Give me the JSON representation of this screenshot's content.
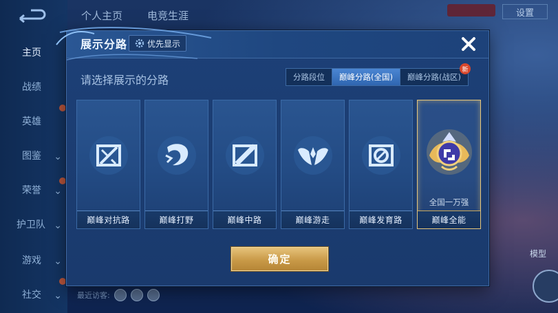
{
  "background": {
    "top_tabs": [
      "个人主页",
      "电竞生涯"
    ],
    "settings_label": "设置",
    "sidebar": {
      "items": [
        {
          "label": "主页",
          "active": true
        },
        {
          "label": "战绩"
        },
        {
          "label": "英雄"
        },
        {
          "label": "图鉴"
        },
        {
          "label": "荣誉"
        },
        {
          "label": "护卫队"
        },
        {
          "label": "游戏"
        },
        {
          "label": "社交"
        }
      ]
    },
    "recent_visitors_label": "最近访客:",
    "model_label": "模型"
  },
  "dialog": {
    "title": "展示分路",
    "priority_label": "优先显示",
    "prompt": "请选择展示的分路",
    "segments": [
      {
        "label": "分路段位",
        "active": false
      },
      {
        "label": "巅峰分路(全国)",
        "active": true
      },
      {
        "label": "巅峰分路(战区)",
        "active": false,
        "badge": "新"
      }
    ],
    "cards": [
      {
        "label": "巅峰对抗路",
        "icon": "sword-lane-icon"
      },
      {
        "label": "巅峰打野",
        "icon": "dragon-jungle-icon"
      },
      {
        "label": "巅峰中路",
        "icon": "mid-lane-icon"
      },
      {
        "label": "巅峰游走",
        "icon": "wings-support-icon"
      },
      {
        "label": "巅峰发育路",
        "icon": "farm-lane-icon"
      },
      {
        "label": "巅峰全能",
        "icon": "allround-emblem-icon",
        "rank": "全国一万强",
        "selected": true
      }
    ],
    "confirm_label": "确定"
  },
  "colors": {
    "accent_gold": "#e6c27a",
    "active_tab": "#3f78c6",
    "panel": "#1d4077"
  }
}
